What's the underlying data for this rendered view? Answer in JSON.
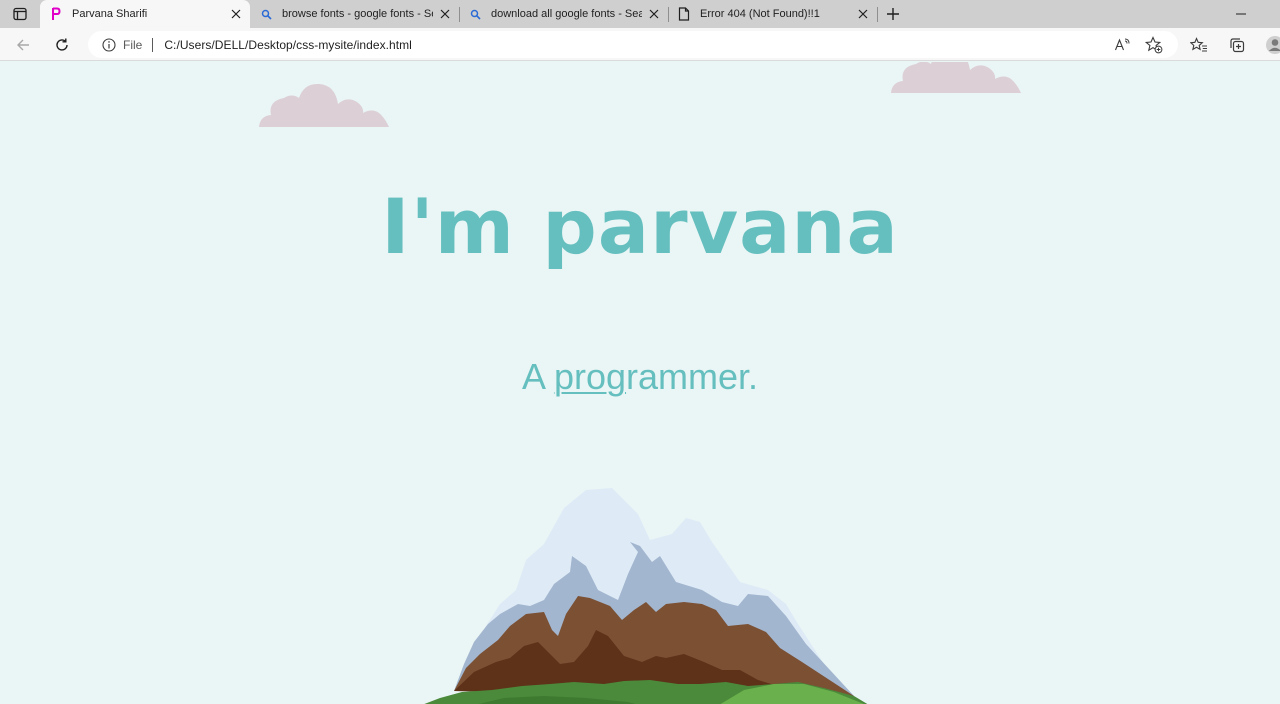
{
  "browser": {
    "tabs": [
      {
        "title": "Parvana Sharifi",
        "favicon": "p-letter-icon",
        "active": true
      },
      {
        "title": "browse fonts - google fonts - Search",
        "favicon": "search-icon",
        "active": false
      },
      {
        "title": "download all google fonts - Search",
        "favicon": "search-icon",
        "active": false
      },
      {
        "title": "Error 404 (Not Found)!!1",
        "favicon": "document-icon",
        "active": false
      }
    ],
    "address": {
      "scheme_label": "File",
      "url": "C:/Users/DELL/Desktop/css-mysite/index.html"
    }
  },
  "page": {
    "headline": "I'm parvana",
    "subline_prefix": "A ",
    "subline_underlined": "prog",
    "subline_rest": "rammer.",
    "colors": {
      "text": "#66bfbf",
      "background": "#eaf5f5",
      "cloud": "#dccfd5"
    }
  }
}
